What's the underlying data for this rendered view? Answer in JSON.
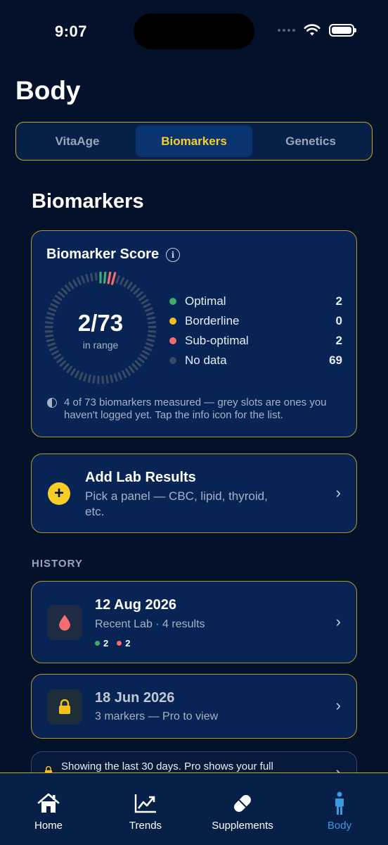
{
  "status_bar": {
    "time": "9:07"
  },
  "page": {
    "title": "Body"
  },
  "segments": [
    {
      "label": "VitaAge",
      "active": false
    },
    {
      "label": "Biomarkers",
      "active": true
    },
    {
      "label": "Genetics",
      "active": false
    }
  ],
  "section_title": "Biomarkers",
  "score_card": {
    "title": "Biomarker Score",
    "value": "2/73",
    "value_sub": "in range",
    "measured_fraction": 0.055,
    "legend": [
      {
        "label": "Optimal",
        "count": "2",
        "color": "#3fae6b"
      },
      {
        "label": "Borderline",
        "count": "0",
        "color": "#f2c21b"
      },
      {
        "label": "Sub-optimal",
        "count": "2",
        "color": "#f16e6e"
      },
      {
        "label": "No data",
        "count": "69",
        "color": "#3a4a63"
      }
    ],
    "note": "4 of 73 biomarkers measured — grey slots are ones you haven't logged yet. Tap the info icon for the list."
  },
  "add_lab": {
    "title": "Add Lab Results",
    "subtitle": "Pick a panel — CBC, lipid, thyroid, etc."
  },
  "history": {
    "label": "HISTORY",
    "items": [
      {
        "date": "12 Aug 2026",
        "subtitle": "Recent Lab · 4 results",
        "optimal_count": "2",
        "suboptimal_count": "2",
        "icon": "drop-icon"
      },
      {
        "date": "18 Jun 2026",
        "subtitle": "3 markers — Pro to view",
        "icon": "lock-icon"
      }
    ],
    "banner": "Showing the last 30 days. Pro shows your full"
  },
  "tabs": [
    {
      "label": "Home",
      "icon": "home-icon",
      "active": false
    },
    {
      "label": "Trends",
      "icon": "trends-icon",
      "active": false
    },
    {
      "label": "Supplements",
      "icon": "pill-icon",
      "active": false
    },
    {
      "label": "Body",
      "icon": "person-icon",
      "active": true
    }
  ],
  "colors": {
    "accent": "#f7cd28",
    "background": "#03112a",
    "card": "#082455",
    "border": "#c9a431",
    "active_tab": "#3a9be0"
  }
}
